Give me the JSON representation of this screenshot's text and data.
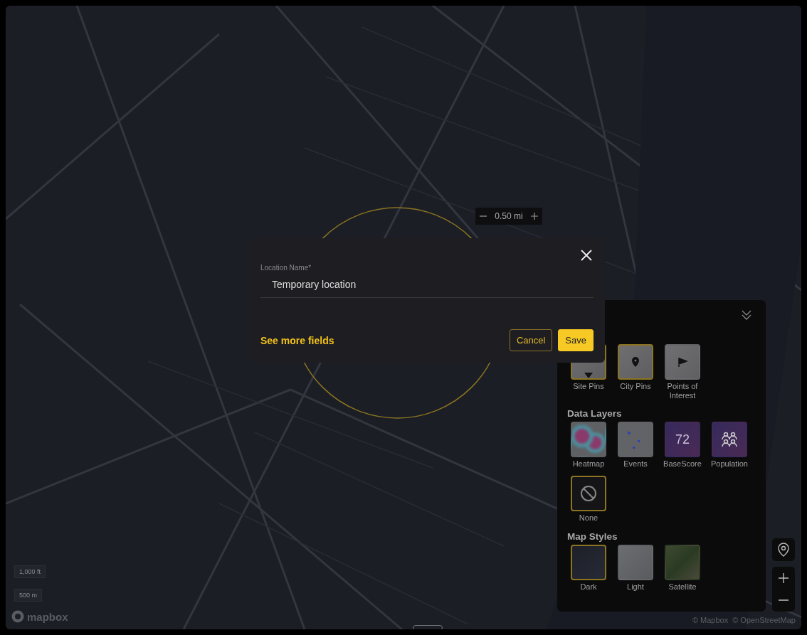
{
  "map": {
    "radius_control": {
      "value": "0.50 mi"
    },
    "scale": [
      "1,000 ft",
      "500 m"
    ],
    "attribution": [
      "© Mapbox",
      "© OpenStreetMap"
    ],
    "logo": "mapbox"
  },
  "dialog": {
    "field": {
      "label": "Location Name",
      "required_mark": "*",
      "value": "Temporary location"
    },
    "link": "See more fields",
    "buttons": [
      {
        "label": "Cancel",
        "kind": "secondary"
      },
      {
        "label": "Save",
        "kind": "primary"
      }
    ]
  },
  "layers_panel": {
    "expanded": true,
    "sections": [
      {
        "options": [
          {
            "label": "Site Pins",
            "kind": "site-pin",
            "selected": true
          },
          {
            "label": "City Pins",
            "kind": "city-pin",
            "selected": true
          },
          {
            "label": "Points of Interest",
            "kind": "flag",
            "selected": false
          }
        ]
      },
      {
        "title": "Data Layers",
        "options": [
          {
            "label": "Heatmap",
            "kind": "heatmap",
            "selected": false
          },
          {
            "label": "Events",
            "kind": "events",
            "selected": false
          },
          {
            "label": "BaseScore",
            "kind": "score",
            "badge": "72",
            "selected": false
          },
          {
            "label": "Population",
            "kind": "population",
            "selected": false
          },
          {
            "label": "None",
            "kind": "none",
            "selected": true
          }
        ]
      },
      {
        "title": "Map Styles",
        "options": [
          {
            "label": "Dark",
            "kind": "dark",
            "selected": true
          },
          {
            "label": "Light",
            "kind": "light",
            "selected": false
          },
          {
            "label": "Satellite",
            "kind": "satellite",
            "selected": false
          }
        ]
      }
    ]
  }
}
